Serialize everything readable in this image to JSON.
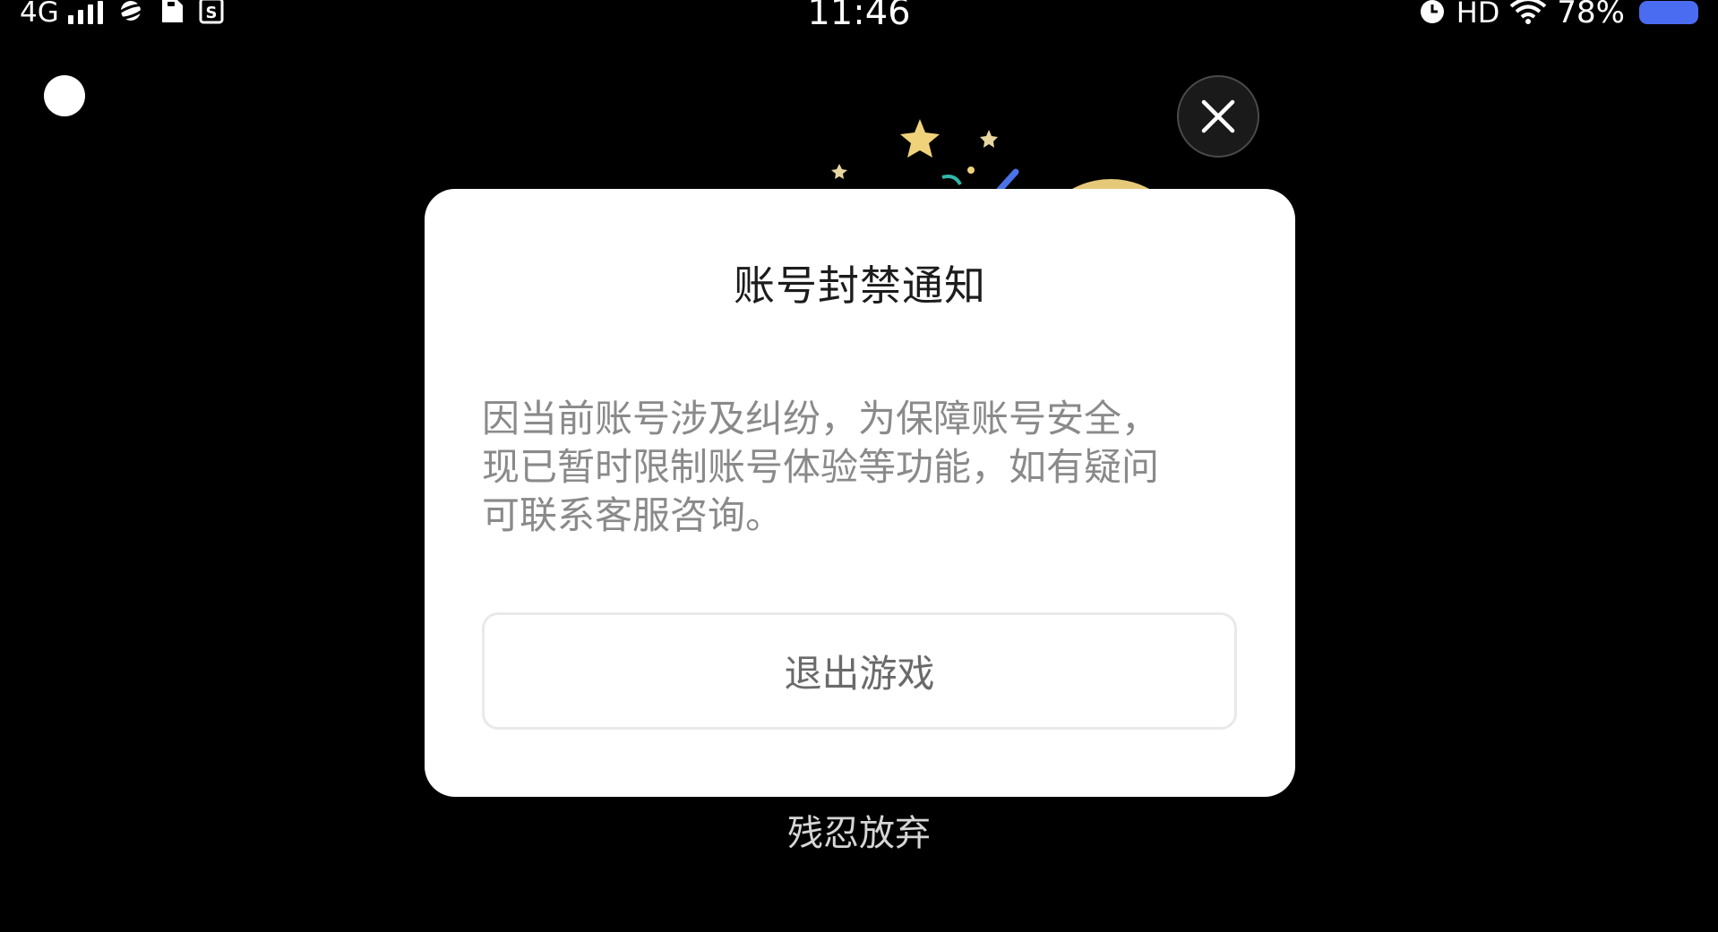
{
  "status_bar": {
    "network": "4G",
    "time": "11:46",
    "hd": "HD",
    "battery": "78%",
    "icons": [
      "signal-icon",
      "planet-app-icon",
      "sim-card-icon",
      "s-app-icon",
      "alarm-icon",
      "wifi-icon",
      "battery-icon"
    ]
  },
  "dialog": {
    "title": "账号封禁通知",
    "body_lines": [
      "因当前账号涉及纠纷，为保障账号安全，",
      "现已暂时限制账号体验等功能，如有疑问",
      "可联系客服咨询。"
    ],
    "exit_button": "退出游戏"
  },
  "abandon_link": "残忍放弃",
  "close_icon": "close-icon",
  "colors": {
    "background": "#000000",
    "dialog": "#ffffff",
    "battery": "#4a6cf0",
    "star": "#f0d27a"
  }
}
